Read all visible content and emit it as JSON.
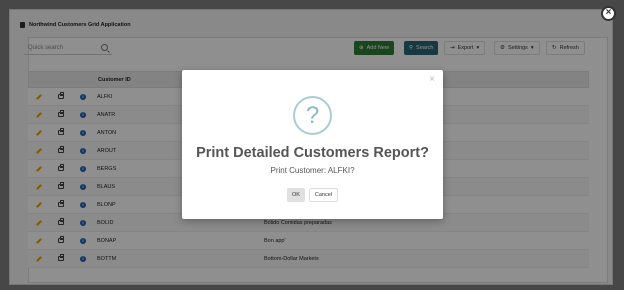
{
  "app": {
    "title": "Northwind Customers Grid Application"
  },
  "toolbar": {
    "search_placeholder": "Quick search",
    "add_label": "Add New",
    "search_label": "Search",
    "export_label": "Export",
    "settings_label": "Settings",
    "refresh_label": "Refresh"
  },
  "grid": {
    "columns": [
      "Customer ID"
    ],
    "rows": [
      {
        "id": "ALFKI",
        "name": ""
      },
      {
        "id": "ANATR",
        "name": ""
      },
      {
        "id": "ANTON",
        "name": ""
      },
      {
        "id": "AROUT",
        "name": ""
      },
      {
        "id": "BERGS",
        "name": ""
      },
      {
        "id": "BLAUS",
        "name": ""
      },
      {
        "id": "BLONP",
        "name": ""
      },
      {
        "id": "BOLID",
        "name": "Bólido Comidas preparadas"
      },
      {
        "id": "BONAP",
        "name": "Bon app'"
      },
      {
        "id": "BOTTM",
        "name": "Bottom-Dollar Markets"
      }
    ]
  },
  "modal": {
    "icon_glyph": "?",
    "title": "Print Detailed Customers Report?",
    "subtitle": "Print Customer: ALFKI?",
    "ok_label": "OK",
    "cancel_label": "Cancel"
  },
  "colors": {
    "add_button": "#2e7d32",
    "search_button": "#2b6777",
    "info_icon": "#1a5fb4",
    "edit_icon": "#e0a000"
  }
}
